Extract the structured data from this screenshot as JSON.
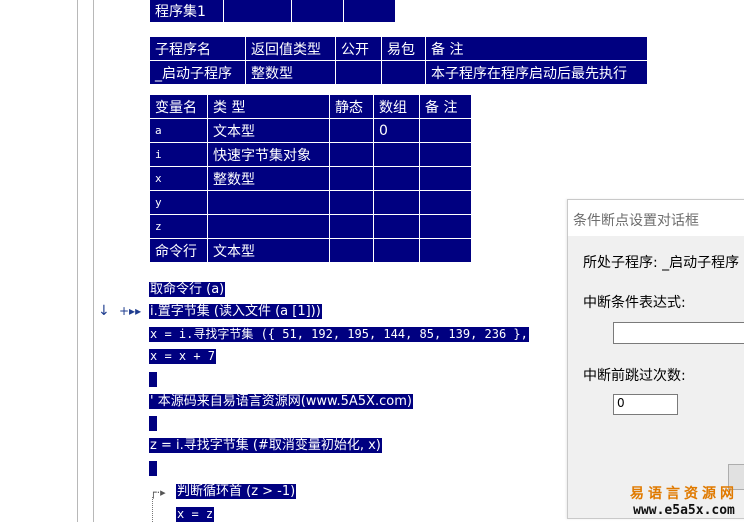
{
  "assembly": {
    "name": "程序集1"
  },
  "sub_table": {
    "headers": [
      "子程序名",
      "返回值类型",
      "公开",
      "易包",
      "备 注"
    ],
    "row": [
      "_启动子程序",
      "整数型",
      "",
      "",
      "本子程序在程序启动后最先执行"
    ]
  },
  "var_table": {
    "headers": [
      "变量名",
      "类 型",
      "静态",
      "数组",
      "备 注"
    ],
    "rows": [
      [
        "a",
        "文本型",
        "",
        "0",
        ""
      ],
      [
        "i",
        "快速字节集对象",
        "",
        "",
        ""
      ],
      [
        "x",
        "整数型",
        "",
        "",
        ""
      ],
      [
        "y",
        "",
        "",
        "",
        ""
      ],
      [
        "z",
        "",
        "",
        "",
        ""
      ],
      [
        "命令行",
        "文本型",
        "",
        "",
        ""
      ]
    ]
  },
  "code": [
    "取命令行 (a)",
    "i.置字节集 (读入文件 (a [1]))",
    "x = i.寻找字节集 ({ 51, 192, 195, 144, 85, 139, 236 },",
    "x = x + 7",
    "",
    "' 本源码来自易语言资源网(www.5A5X.com)",
    "",
    "z = i.寻找字节集 (#取消变量初始化, x)",
    "",
    "判断循环首 (z > -1)",
    "x = z"
  ],
  "markers": {
    "breakpoint": "↓",
    "current": "+▸▸",
    "loop": "┌·▸"
  },
  "dialog": {
    "title": "条件断点设置对话框",
    "sub_label": "所处子程序: _启动子程序",
    "cond_label": "中断条件表达式:",
    "cond_value": "",
    "skip_label": "中断前跳过次数:",
    "skip_value": "0"
  },
  "watermark": {
    "line1": "易语言资源网",
    "line2": "www.e5a5x.com"
  }
}
